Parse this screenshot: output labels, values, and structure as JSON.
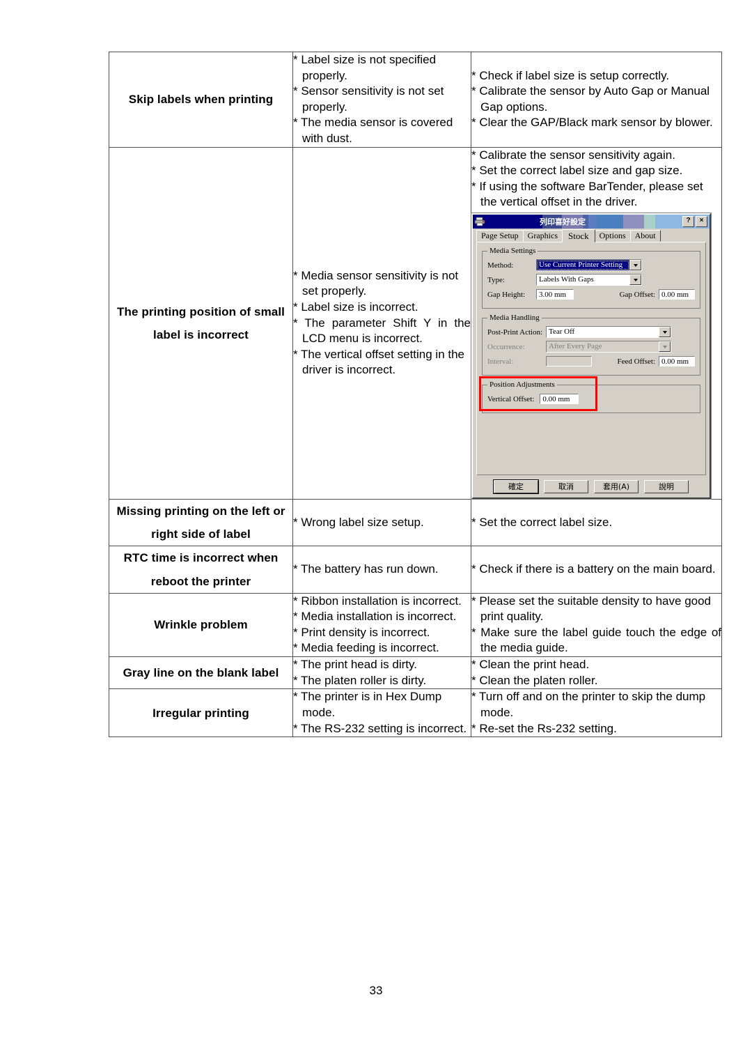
{
  "page": {
    "number": "33"
  },
  "table": {
    "rows": [
      {
        "symptom": "Skip labels when printing",
        "causes": [
          "* Label size is not specified properly.",
          "* Sensor sensitivity is not set properly.",
          "* The media sensor is covered with dust."
        ],
        "solutions": [
          "* Check if label size is setup correctly.",
          "* Calibrate the sensor by Auto Gap or Manual Gap options.",
          "* Clear the GAP/Black mark sensor by blower."
        ]
      },
      {
        "symptom_line1": "The printing position of small",
        "symptom_line2": "label is incorrect",
        "causes": [
          "* Media sensor sensitivity is not set properly.",
          "* Label size is incorrect.",
          "* The parameter Shift Y in the LCD menu is incorrect.",
          "* The vertical offset setting in the driver is incorrect."
        ],
        "solutions": [
          "* Calibrate the sensor sensitivity again.",
          "* Set the correct label size and gap size.",
          "* If using the software BarTender, please set the vertical offset in the driver."
        ]
      },
      {
        "symptom_line1": "Missing printing on the left or",
        "symptom_line2": "right side of label",
        "causes": [
          "* Wrong label size setup."
        ],
        "solutions": [
          "* Set the correct label size."
        ]
      },
      {
        "symptom_line1": "RTC time is incorrect when",
        "symptom_line2": "reboot the printer",
        "causes": [
          "* The battery has run down."
        ],
        "solutions": [
          "* Check if there is a battery on the main board."
        ]
      },
      {
        "symptom": "Wrinkle problem",
        "causes": [
          "* Ribbon installation is incorrect.",
          "* Media installation is incorrect.",
          "* Print density is incorrect.",
          "* Media feeding is incorrect."
        ],
        "solutions": [
          "* Please set the suitable density to have good print quality.",
          "* Make sure the label guide touch the edge of the media guide."
        ]
      },
      {
        "symptom": "Gray line on the blank label",
        "causes": [
          "* The print head is dirty.",
          "* The platen roller is dirty."
        ],
        "solutions": [
          "* Clean the print head.",
          "* Clean the platen roller."
        ]
      },
      {
        "symptom": "Irregular printing",
        "causes": [
          "* The printer is in Hex Dump mode.",
          "* The RS-232 setting is incorrect."
        ],
        "solutions": [
          "* Turn off and on the printer to skip the dump mode.",
          "* Re-set the Rs-232 setting."
        ]
      }
    ]
  },
  "dialog": {
    "title": "列印喜好設定",
    "titlebar_buttons": {
      "help": "?",
      "close": "×"
    },
    "tabs": [
      {
        "label": "Page Setup",
        "active": false
      },
      {
        "label": "Graphics",
        "active": false
      },
      {
        "label": "Stock",
        "active": true
      },
      {
        "label": "Options",
        "active": false
      },
      {
        "label": "About",
        "active": false
      }
    ],
    "media_settings": {
      "legend": "Media Settings",
      "method_label": "Method:",
      "method_value": "Use Current Printer Setting",
      "type_label": "Type:",
      "type_value": "Labels With Gaps",
      "gap_height_label": "Gap Height:",
      "gap_height_value": "3.00 mm",
      "gap_offset_label": "Gap Offset:",
      "gap_offset_value": "0.00 mm"
    },
    "media_handling": {
      "legend": "Media Handling",
      "post_print_label": "Post-Print Action:",
      "post_print_value": "Tear Off",
      "occurrence_label": "Occurrence:",
      "occurrence_value": "After Every Page",
      "interval_label": "Interval:",
      "interval_value": "",
      "feed_offset_label": "Feed Offset:",
      "feed_offset_value": "0.00 mm"
    },
    "position_adjustments": {
      "legend": "Position Adjustments",
      "vertical_offset_label": "Vertical Offset:",
      "vertical_offset_value": "0.00 mm"
    },
    "buttons": {
      "ok": "確定",
      "cancel": "取消",
      "apply": "套用(A)",
      "help": "說明"
    },
    "highlight_color": "#ff0000"
  }
}
